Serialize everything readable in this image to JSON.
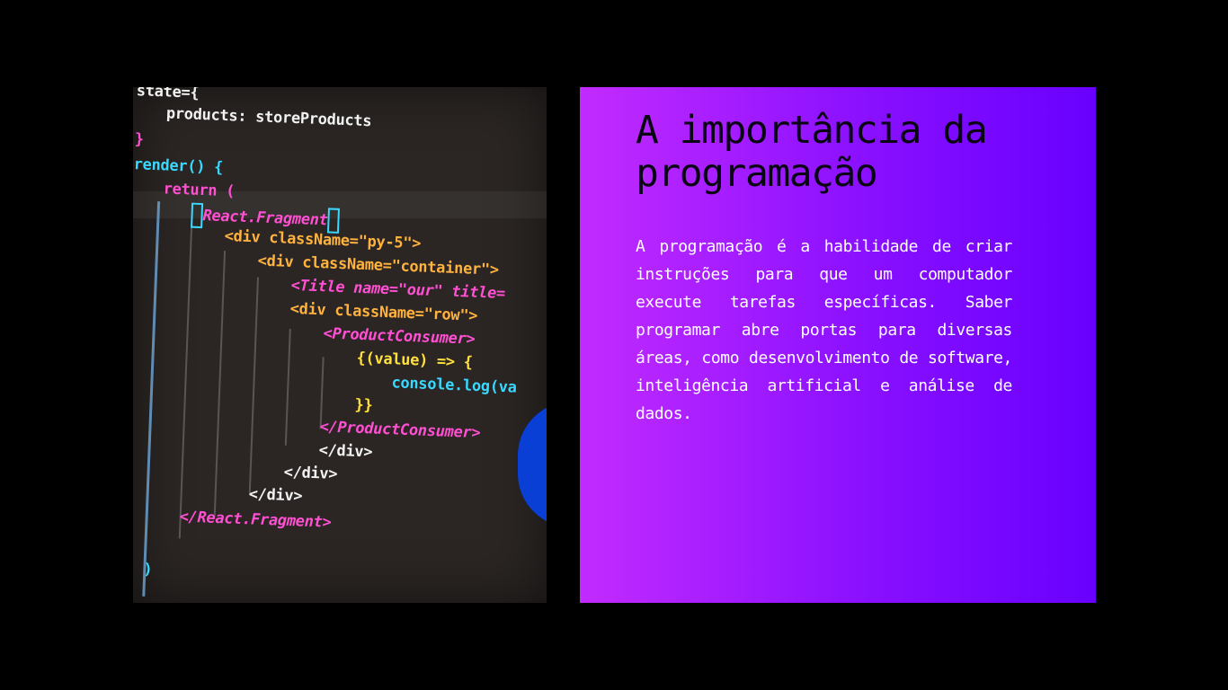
{
  "slide": {
    "title": "A importância da programação",
    "body": "A programação é a habilidade de criar instruções para que um computador execute tarefas específicas. Saber programar abre portas para diversas áreas, como desenvolvimento de software, inteligência artificial e análise de dados."
  },
  "photo": {
    "subject": "code-editor-photo",
    "code_lines": [
      "state={",
      "products: storeProducts",
      "}",
      "render() {",
      "return (",
      "React.Fragment",
      "<div className=\"py-5\">",
      "<div className=\"container\">",
      "<Title name=\"our\" title=",
      "<div className=\"row\">",
      "<ProductConsumer>",
      "{(value) => {",
      "console.log(va",
      "}}",
      "</ProductConsumer>",
      "</div>",
      "</div>",
      "</div>",
      "</React.Fragment>",
      ")"
    ]
  },
  "colors": {
    "background": "#000000",
    "panel_gradient_start": "#c22bff",
    "panel_gradient_end": "#6800ff",
    "title_color": "#0a0512",
    "body_color": "#ffffff"
  }
}
